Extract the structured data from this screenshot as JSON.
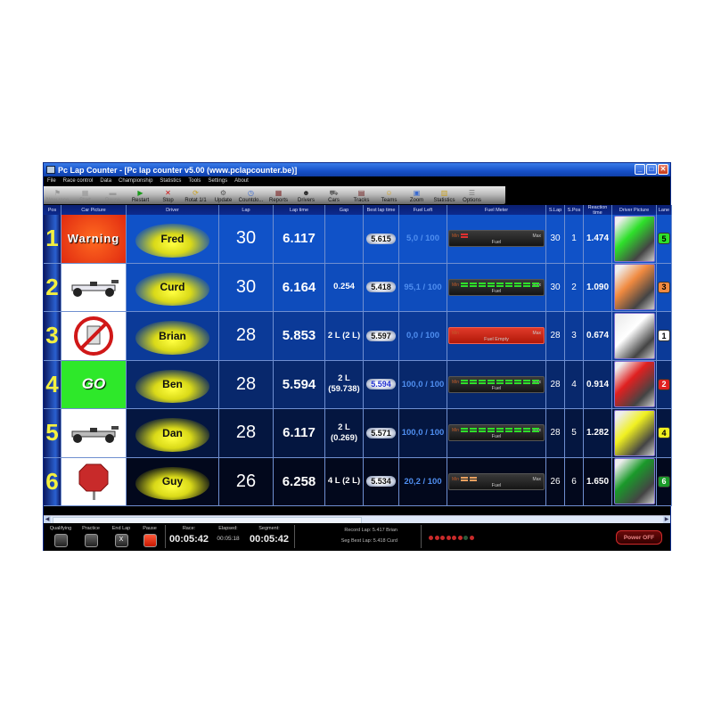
{
  "window": {
    "title": "Pc Lap Counter - [Pc lap counter v5.00 (www.pclapcounter.be)]",
    "controls": [
      "minimize",
      "maximize",
      "close"
    ]
  },
  "menu": [
    "File",
    "Race control",
    "Data",
    "Championship",
    "Statistics",
    "Tools",
    "Settings",
    "About"
  ],
  "toolbar": [
    {
      "label": "New race",
      "icon": "flag-icon",
      "glyph": "⚑",
      "enabled": false
    },
    {
      "label": "Start",
      "icon": "start-icon",
      "glyph": "▦",
      "enabled": false
    },
    {
      "label": "Pause",
      "icon": "pause-icon",
      "glyph": "▬",
      "enabled": false
    },
    {
      "label": "Restart",
      "icon": "restart-icon",
      "glyph": "▶",
      "enabled": true,
      "color": "#1a9a1a"
    },
    {
      "label": "Stop",
      "icon": "stop-icon",
      "glyph": "✕",
      "enabled": true,
      "color": "#d01010"
    },
    {
      "label": "Rotat 1/1",
      "icon": "rotate-icon",
      "glyph": "⟳",
      "enabled": true,
      "color": "#c8a020"
    },
    {
      "label": "Update",
      "icon": "update-icon",
      "glyph": "⚙",
      "enabled": true,
      "color": "#555"
    },
    {
      "label": "Countdo...",
      "icon": "countdown-icon",
      "glyph": "◷",
      "enabled": true,
      "color": "#3a6ad0"
    },
    {
      "label": "Reports",
      "icon": "reports-icon",
      "glyph": "▦",
      "enabled": true,
      "color": "#803030"
    },
    {
      "label": "Drivers",
      "icon": "drivers-icon",
      "glyph": "☻",
      "enabled": true,
      "color": "#222"
    },
    {
      "label": "Cars",
      "icon": "cars-icon",
      "glyph": "⛟",
      "enabled": true,
      "color": "#666"
    },
    {
      "label": "Tracks",
      "icon": "tracks-icon",
      "glyph": "▤",
      "enabled": true,
      "color": "#702020"
    },
    {
      "label": "Teams",
      "icon": "teams-icon",
      "glyph": "☺",
      "enabled": true,
      "color": "#d0a020"
    },
    {
      "label": "Zoom",
      "icon": "zoom-icon",
      "glyph": "▣",
      "enabled": true,
      "color": "#3a6ad0"
    },
    {
      "label": "Statistics",
      "icon": "statistics-icon",
      "glyph": "▥",
      "enabled": true,
      "color": "#c8a020"
    },
    {
      "label": "Options",
      "icon": "options-icon",
      "glyph": "☰",
      "enabled": true,
      "color": "#777"
    }
  ],
  "columns": [
    "Pos",
    "Car Picture",
    "Driver",
    "Lap",
    "Lap time",
    "Gap",
    "Best lap time",
    "Fuel Left",
    "Fuel Meter",
    "S.Lap",
    "S.Pos",
    "Reaction time",
    "Driver Picture",
    "Lane"
  ],
  "rows": [
    {
      "pos": "1",
      "car": "Warning",
      "car_type": "warning",
      "driver": "Fred",
      "lap": "30",
      "lap_time": "6.117",
      "gap": "",
      "best": "5.615",
      "best_highlight": false,
      "fuel_left": "5,0 / 100",
      "fuel_pct": 5,
      "meter_label": "Fuel",
      "meter_state": "low",
      "s_lap": "30",
      "s_pos": "1",
      "reaction": "1.474",
      "lane": "5",
      "lane_color": "#2ee02a",
      "row_bg": "#1052c8"
    },
    {
      "pos": "2",
      "car": "",
      "car_type": "f1-white",
      "driver": "Curd",
      "lap": "30",
      "lap_time": "6.164",
      "gap": "0.254",
      "best": "5.418",
      "best_highlight": false,
      "fuel_left": "95,1 / 100",
      "fuel_pct": 95.1,
      "meter_label": "Fuel",
      "meter_state": "ok",
      "s_lap": "30",
      "s_pos": "2",
      "reaction": "1.090",
      "lane": "3",
      "lane_color": "#f08a40",
      "row_bg": "#0e4cbc"
    },
    {
      "pos": "3",
      "car": "",
      "car_type": "no-fuel",
      "driver": "Brian",
      "lap": "28",
      "lap_time": "5.853",
      "gap": "2 L (2 L)",
      "best": "5.597",
      "best_highlight": false,
      "fuel_left": "0,0 / 100",
      "fuel_pct": 0,
      "meter_label": "Fuel Empty",
      "meter_state": "empty",
      "s_lap": "28",
      "s_pos": "3",
      "reaction": "0.674",
      "lane": "1",
      "lane_color": "#ffffff",
      "row_bg": "#0b3a98"
    },
    {
      "pos": "4",
      "car": "GO",
      "car_type": "go",
      "driver": "Ben",
      "lap": "28",
      "lap_time": "5.594",
      "gap": "2 L\n(59.738)",
      "best": "5.594",
      "best_highlight": true,
      "fuel_left": "100,0 / 100",
      "fuel_pct": 100,
      "meter_label": "Fuel",
      "meter_state": "ok",
      "s_lap": "28",
      "s_pos": "4",
      "reaction": "0.914",
      "lane": "2",
      "lane_color": "#e02020",
      "row_bg": "#08286c"
    },
    {
      "pos": "5",
      "car": "",
      "car_type": "f1-silver",
      "driver": "Dan",
      "lap": "28",
      "lap_time": "6.117",
      "gap": "2 L\n(0.269)",
      "best": "5.571",
      "best_highlight": false,
      "fuel_left": "100,0 / 100",
      "fuel_pct": 100,
      "meter_label": "Fuel",
      "meter_state": "ok",
      "s_lap": "28",
      "s_pos": "5",
      "reaction": "1.282",
      "lane": "4",
      "lane_color": "#f0f020",
      "row_bg": "#041640"
    },
    {
      "pos": "6",
      "car": "",
      "car_type": "stop-sign",
      "driver": "Guy",
      "lap": "26",
      "lap_time": "6.258",
      "gap": "4 L (2 L)",
      "best": "5.534",
      "best_highlight": false,
      "fuel_left": "20,2 / 100",
      "fuel_pct": 20.2,
      "meter_label": "Fuel",
      "meter_state": "mid",
      "s_lap": "26",
      "s_pos": "6",
      "reaction": "1.650",
      "lane": "6",
      "lane_color": "#1a9a2a",
      "row_bg": "#02081c"
    }
  ],
  "meter": {
    "min": "Min",
    "max": "Max"
  },
  "bottom": {
    "modes": [
      {
        "label": "Qualifying",
        "state": "off"
      },
      {
        "label": "Practice",
        "state": "off"
      },
      {
        "label": "End Lap",
        "state": "x"
      },
      {
        "label": "Pause",
        "state": "on"
      }
    ],
    "race_label": "Race:",
    "race": "00:05:42",
    "elapsed_label": "Elapsed:",
    "elapsed": "00:05:18",
    "segment_label": "Segment:",
    "segment": "00:05:42",
    "record_lap_label": "Record Lap:",
    "record_lap": "5.417 Brian",
    "seg_best_label": "Seg Best Lap:",
    "seg_best": "5.418 Curd",
    "lights": [
      "red",
      "red",
      "red",
      "red",
      "red",
      "red",
      "off",
      "red"
    ],
    "power_label": "Power OFF"
  }
}
